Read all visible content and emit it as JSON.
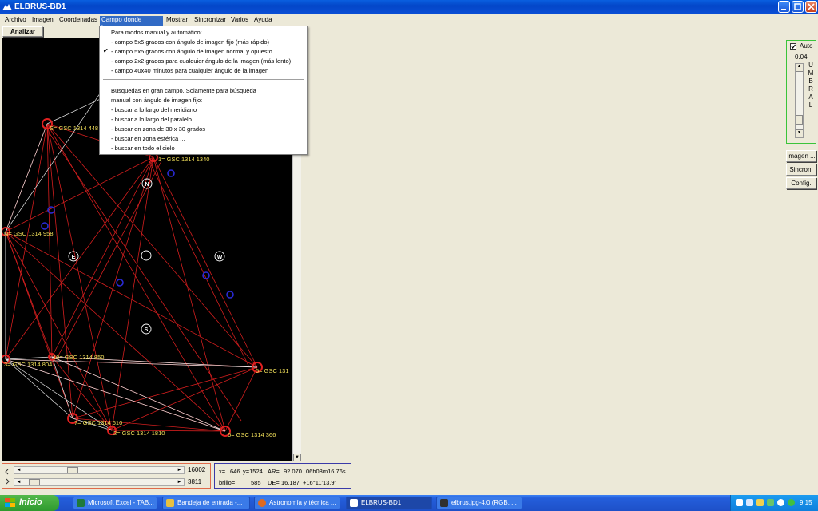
{
  "window": {
    "title": "ELBRUS-BD1"
  },
  "menubar": {
    "items": [
      "Archivo",
      "Imagen",
      "Coordenadas",
      "Campo donde buscar",
      "Mostrar",
      "Sincronizar",
      "Varios",
      "Ayuda"
    ],
    "active_index": 3
  },
  "toolbar": {
    "analyze_label": "Analizar"
  },
  "dropdown": {
    "header1": "Para modos manual y automático:",
    "options": [
      " - campo 5x5 grados con ángulo de imagen fijo (más rápido)",
      " - campo 5x5 grados con ángulo de imagen normal y opuesto",
      " - campo 2x2 grados para cualquier ángulo de la imagen (más lento)",
      " - campo 40x40 minutos para cualquier ángulo de la imagen"
    ],
    "checked_index": 1,
    "checkmark": "✔",
    "header2_line1": "Búsquedas en gran campo. Solamente para búsqueda",
    "header2_line2": "manual con ángulo de imagen fijo:",
    "wide_options": [
      " - buscar a lo largo del meridiano",
      " - buscar a lo largo del paralelo",
      " - buscar en zona de 30 x 30 grados",
      " - buscar en zona esférica ...",
      " - buscar en todo el cielo"
    ]
  },
  "sky": {
    "star_labels": [
      "S= GSC 1314 448",
      "1= GSC 1314 1340",
      "N= GSC 1314 958",
      "3= GSC 1314 804",
      "10= GSC 1314 850",
      "5= GSC 131",
      "7= GSC 1314 610",
      "2= GSC 1314 1810",
      "6= GSC 1314 366"
    ],
    "compass": {
      "north": "N",
      "south": "S",
      "east": "E",
      "west": "W"
    },
    "colors": {
      "line_red": "#d21e1e",
      "line_white": "#e6e6e6",
      "star_red": "#e02020",
      "star_blue": "#2a2ad8",
      "label_yellow": "#f2e05a"
    }
  },
  "scrollers": {
    "value1": "16002",
    "value2": "3811"
  },
  "coords": {
    "line1_x": "x=",
    "line1_xval": "646",
    "line1_y": "y=1524",
    "line1_ar": "AR=",
    "line1_arval": "92.070",
    "line1_hms": "06h08m16.76s",
    "line2_brillo": "brillo=",
    "line2_brillo_val": "585",
    "line2_de": "DE=",
    "line2_de_val": "16.187",
    "line2_dms": "+16°11'13.9\""
  },
  "right_panel": {
    "auto_label": "Auto",
    "auto_checked": true,
    "threshold_value": "0.04",
    "umbral_letters": [
      "U",
      "M",
      "B",
      "R",
      "A",
      "L"
    ],
    "buttons": [
      "Imagen ...",
      "Sincron.",
      "Config."
    ]
  },
  "taskbar": {
    "start_label": "Inicio",
    "items": [
      {
        "label": "Microsoft Excel - TAB...",
        "icon_color": "#1f7a3a"
      },
      {
        "label": "Bandeja de entrada -...",
        "icon_color": "#e8c040"
      },
      {
        "label": "Astronomía y técnica ...",
        "icon_color": "#e06a20"
      },
      {
        "label": "ELBRUS-BD1",
        "icon_color": "#ffffff"
      },
      {
        "label": "elbrus.jpg-4.0 (RGB, ...",
        "icon_color": "#303030"
      }
    ],
    "active_index": 3,
    "clock": "9:15"
  }
}
